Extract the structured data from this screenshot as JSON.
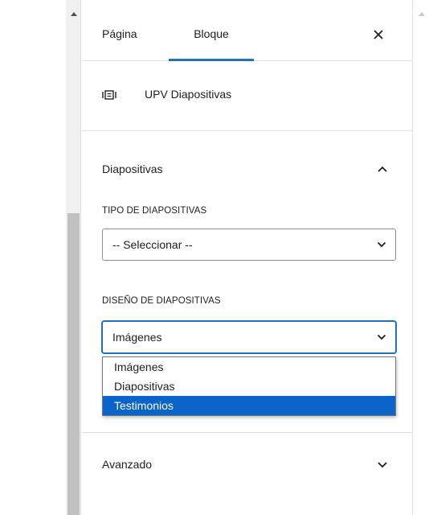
{
  "tabs": {
    "page_label": "Página",
    "block_label": "Bloque",
    "active": "Bloque"
  },
  "close_icon": "close-icon",
  "block": {
    "icon": "slides-icon",
    "title": "UPV Diapositivas"
  },
  "slides_panel": {
    "title": "Diapositivas",
    "expanded": true,
    "type_label": "TIPO DE DIAPOSITIVAS",
    "type_value": "-- Seleccionar --",
    "design_label": "DISEÑO DE DIAPOSITIVAS",
    "design_value": "Imágenes",
    "design_options": [
      "Imágenes",
      "Diapositivas",
      "Testimonios"
    ],
    "highlighted_option": "Testimonios"
  },
  "advanced_panel": {
    "title": "Avanzado",
    "expanded": false
  },
  "colors": {
    "accent": "#2271b1",
    "option_highlight": "#0a63c9",
    "border": "#e0e0e0"
  }
}
